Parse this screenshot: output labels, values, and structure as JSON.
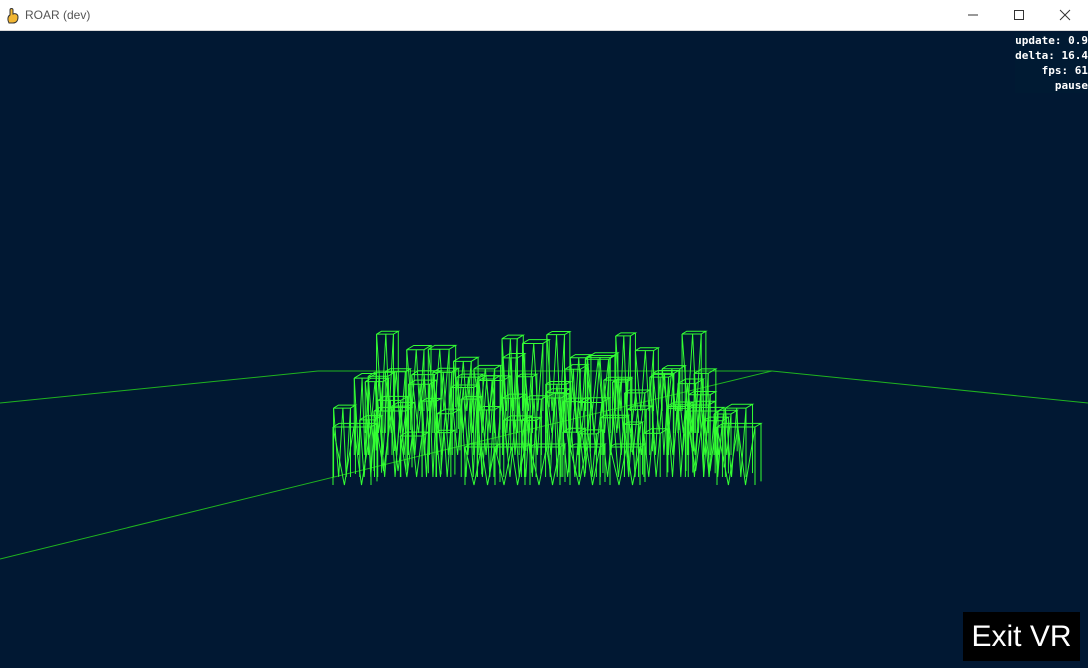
{
  "window": {
    "title": "ROAR (dev)",
    "controls": {
      "minimize_icon": "minimize-icon",
      "maximize_icon": "maximize-icon",
      "close_icon": "close-icon"
    }
  },
  "stats": {
    "update": "update: 0.9",
    "delta": "delta: 16.4",
    "fps": "fps: 61",
    "pause": "pause"
  },
  "vr": {
    "exit_label": "Exit VR"
  },
  "colors": {
    "background": "#011833",
    "wireframe": "#33ff33",
    "grid": "#1fb31f",
    "stats_text": "#ffffff",
    "exit_button_bg": "#000000"
  }
}
